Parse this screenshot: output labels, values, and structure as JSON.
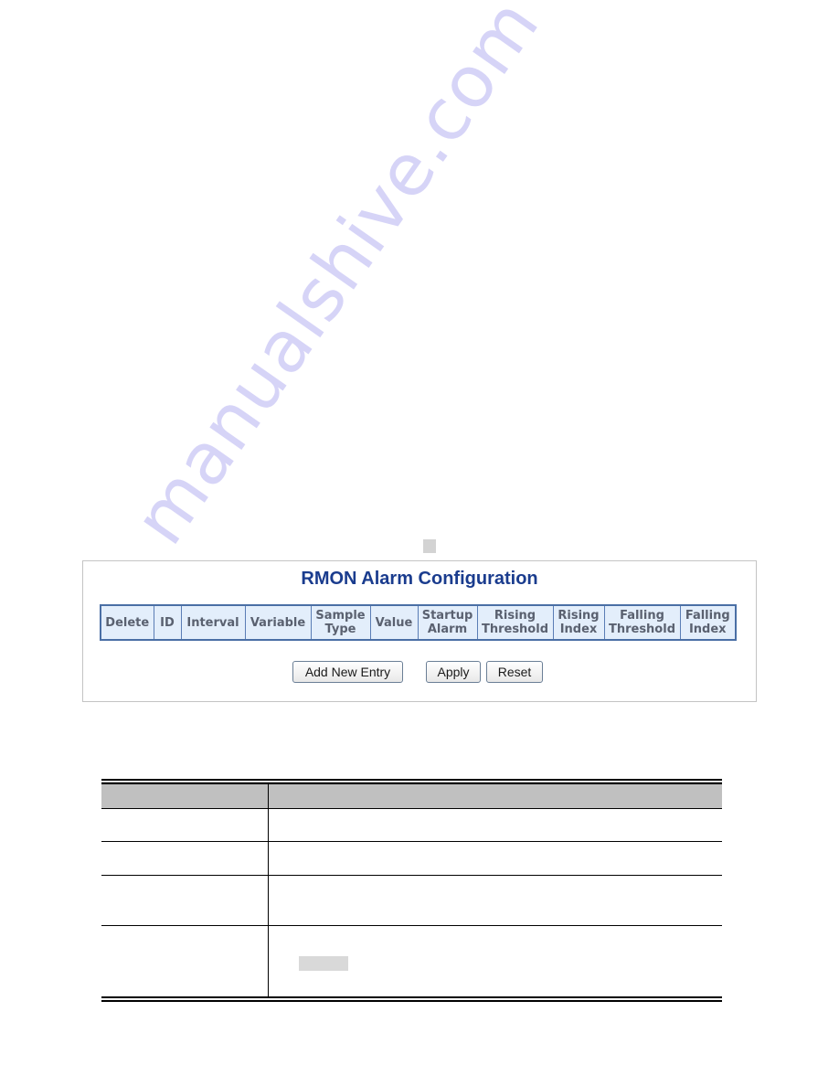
{
  "watermark": {
    "text": "manualshive.com",
    "color": "#c9c6f5"
  },
  "panel": {
    "title": "RMON Alarm Configuration",
    "title_color": "#1a3c8e",
    "table": {
      "header_bg": "#e3eefb",
      "border_color": "#4a6fa5",
      "columns": [
        {
          "line1": "Delete",
          "line2": ""
        },
        {
          "line1": "ID",
          "line2": ""
        },
        {
          "line1": "Interval",
          "line2": ""
        },
        {
          "line1": "Variable",
          "line2": ""
        },
        {
          "line1": "Sample",
          "line2": "Type"
        },
        {
          "line1": "Value",
          "line2": ""
        },
        {
          "line1": "Startup",
          "line2": "Alarm"
        },
        {
          "line1": "Rising",
          "line2": "Threshold"
        },
        {
          "line1": "Rising",
          "line2": "Index"
        },
        {
          "line1": "Falling",
          "line2": "Threshold"
        },
        {
          "line1": "Falling",
          "line2": "Index"
        }
      ]
    },
    "buttons": {
      "add_new_entry": "Add New Entry",
      "apply": "Apply",
      "reset": "Reset"
    }
  },
  "description_table": {
    "header_bg": "#c0c0c0",
    "headers": [
      "",
      ""
    ],
    "rows": [
      [
        "",
        ""
      ],
      [
        "",
        ""
      ],
      [
        "",
        ""
      ],
      [
        "",
        ""
      ]
    ]
  }
}
